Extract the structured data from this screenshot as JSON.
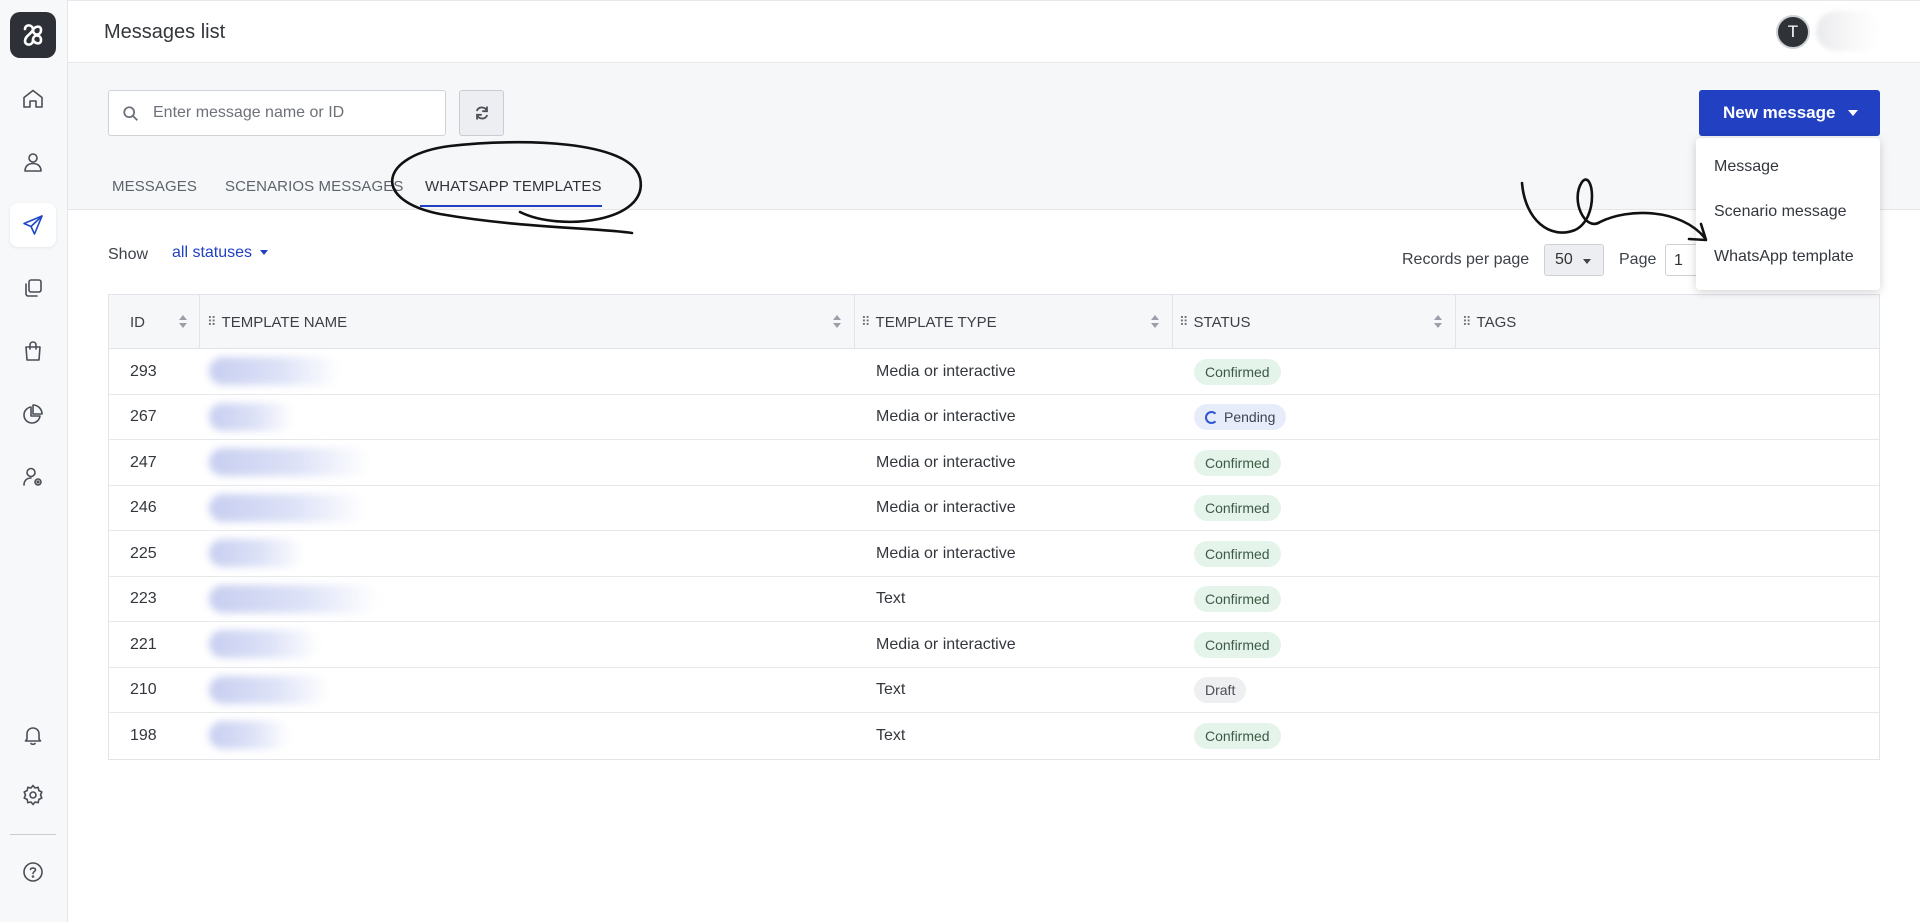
{
  "header": {
    "title": "Messages list",
    "avatar_initial": "T"
  },
  "sidebar": {
    "items": [
      {
        "icon": "home-icon"
      },
      {
        "icon": "user-icon"
      },
      {
        "icon": "send-icon",
        "active": true
      },
      {
        "icon": "copy-icon"
      },
      {
        "icon": "shopping-bag-icon"
      },
      {
        "icon": "pie-chart-icon"
      },
      {
        "icon": "user-settings-icon"
      },
      {
        "icon": "bell-icon"
      },
      {
        "icon": "gear-icon"
      },
      {
        "icon": "help-icon"
      }
    ]
  },
  "toolbar": {
    "search_placeholder": "Enter message name or ID",
    "new_message_label": "New message"
  },
  "tabs": [
    {
      "label": "MESSAGES"
    },
    {
      "label": "SCENARIOS MESSAGES"
    },
    {
      "label": "WHATSAPP TEMPLATES",
      "active": true
    }
  ],
  "filters": {
    "show_label": "Show",
    "status_value": "all statuses",
    "records_per_page_label": "Records per page",
    "records_per_page_value": "50",
    "page_label": "Page",
    "page_value": "1"
  },
  "dropdown_menu": {
    "items": [
      "Message",
      "Scenario message",
      "WhatsApp template"
    ]
  },
  "table": {
    "columns": [
      "ID",
      "TEMPLATE NAME",
      "TEMPLATE TYPE",
      "STATUS",
      "TAGS"
    ],
    "rows": [
      {
        "id": "293",
        "type": "Media or interactive",
        "status": "Confirmed"
      },
      {
        "id": "267",
        "type": "Media or interactive",
        "status": "Pending"
      },
      {
        "id": "247",
        "type": "Media or interactive",
        "status": "Confirmed"
      },
      {
        "id": "246",
        "type": "Media or interactive",
        "status": "Confirmed"
      },
      {
        "id": "225",
        "type": "Media or interactive",
        "status": "Confirmed"
      },
      {
        "id": "223",
        "type": "Text",
        "status": "Confirmed"
      },
      {
        "id": "221",
        "type": "Media or interactive",
        "status": "Confirmed"
      },
      {
        "id": "210",
        "type": "Text",
        "status": "Draft"
      },
      {
        "id": "198",
        "type": "Text",
        "status": "Confirmed"
      }
    ]
  },
  "colors": {
    "accent": "#2141c2",
    "confirmed_bg": "#e4f4ea",
    "pending_bg": "#e6ecfa",
    "draft_bg": "#eeeff1"
  }
}
